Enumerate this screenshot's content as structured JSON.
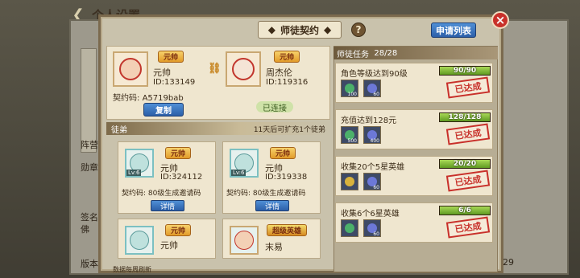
{
  "background": {
    "title": "个人设置",
    "side_labels": [
      "阵营",
      "勋章",
      "签名",
      "佛"
    ],
    "version_label": "版本",
    "version_tail": "29"
  },
  "dialog": {
    "title": "师徒契约",
    "help": "?",
    "apply_list": "申请列表",
    "close": "×"
  },
  "master": {
    "self": {
      "badge": "元帅",
      "name": "元帅",
      "id": "ID:133149"
    },
    "partner": {
      "badge": "元帅",
      "name": "周杰伦",
      "id": "ID:119316"
    },
    "code_label": "契约码:",
    "code_value": "A5719bab",
    "copy_btn": "复制",
    "connected": "已连接"
  },
  "disciples": {
    "header": "徒弟",
    "note": "11天后可扩充1个徒弟",
    "cards": [
      {
        "badge": "元帅",
        "name": "元帅",
        "id": "ID:324112",
        "lv": "Lv:6",
        "code_label": "契约码:",
        "code": "80级生成邀请码",
        "detail": "详情"
      },
      {
        "badge": "元帅",
        "name": "元帅",
        "id": "ID:319338",
        "lv": "Lv:6",
        "code_label": "契约码:",
        "code": "80级生成邀请码",
        "detail": "详情"
      },
      {
        "badge": "元帅",
        "name": "元帅"
      },
      {
        "badge": "超级英雄",
        "name": "末易"
      }
    ],
    "footer": "数据每周刷新"
  },
  "tasks": {
    "header": "师徒任务",
    "count": "28/28",
    "items": [
      {
        "title": "角色等级达到90级",
        "progress": "90/90",
        "fill": 1.0,
        "status": "已达成",
        "rewards": [
          {
            "qty": "100",
            "color": "#4bb06a"
          },
          {
            "qty": "60",
            "color": "#6c78d8"
          }
        ]
      },
      {
        "title": "充值达到128元",
        "progress": "128/128",
        "fill": 1.0,
        "status": "已达成",
        "rewards": [
          {
            "qty": "500",
            "color": "#4bb06a"
          },
          {
            "qty": "400",
            "color": "#6c78d8"
          }
        ]
      },
      {
        "title": "收集20个5星英雄",
        "progress": "20/20",
        "fill": 1.0,
        "status": "已达成",
        "rewards": [
          {
            "qty": "",
            "color": "#d8b23c"
          },
          {
            "qty": "60",
            "color": "#6c78d8"
          }
        ]
      },
      {
        "title": "收集6个6星英雄",
        "progress": "6/6",
        "fill": 1.0,
        "status": "已达成",
        "rewards": [
          {
            "qty": "",
            "color": "#4bb06a"
          },
          {
            "qty": "60",
            "color": "#6c78d8"
          }
        ]
      }
    ]
  }
}
